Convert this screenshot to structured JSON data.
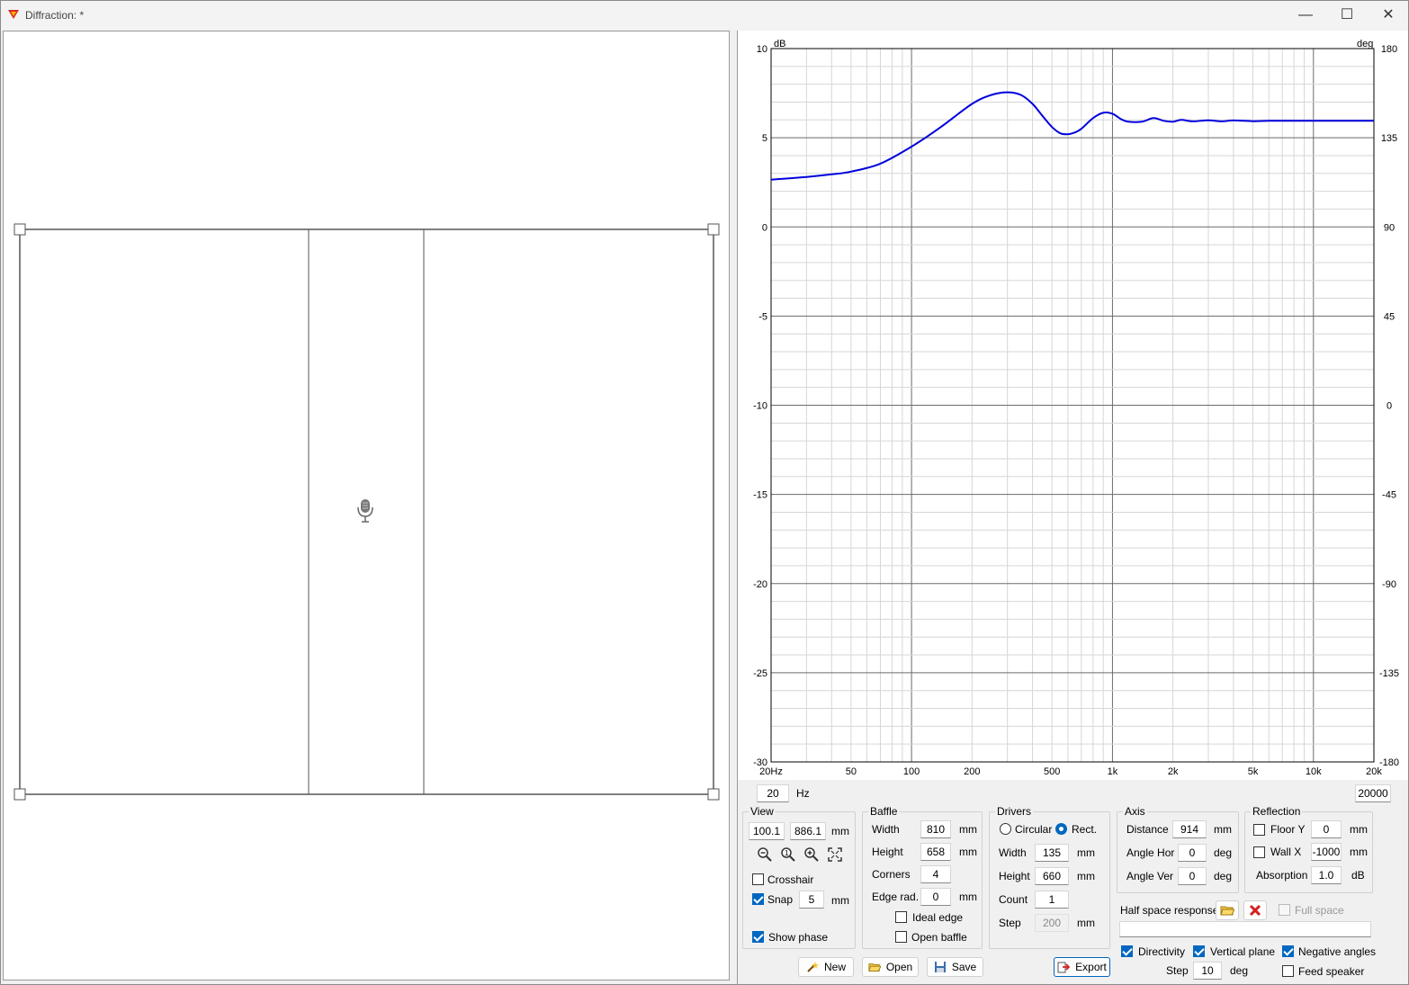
{
  "window": {
    "title": "Diffraction: *",
    "minimize": "—",
    "maximize": "☐",
    "close": "✕"
  },
  "chart_data": {
    "type": "line",
    "title": "",
    "xlabel": "",
    "ylabel": "dB",
    "y2label": "deg",
    "x_scale": "log",
    "xlim": [
      20,
      20000
    ],
    "ylim": [
      -30,
      10
    ],
    "y2lim": [
      -180,
      180
    ],
    "grid": true,
    "x_tick_labels": [
      "20Hz",
      "50",
      "100",
      "200",
      "500",
      "1k",
      "2k",
      "5k",
      "10k",
      "20k"
    ],
    "x_tick_values": [
      20,
      50,
      100,
      200,
      500,
      1000,
      2000,
      5000,
      10000,
      20000
    ],
    "y_tick_labels": [
      "10",
      "5",
      "0",
      "-5",
      "-10",
      "-15",
      "-20",
      "-25",
      "-30"
    ],
    "y2_tick_labels": [
      "180",
      "135",
      "90",
      "45",
      "0",
      "-45",
      "-90",
      "-135",
      "-180"
    ],
    "series": [
      {
        "color": "#0000dd",
        "x": [
          20,
          30,
          40,
          50,
          70,
          100,
          140,
          200,
          250,
          300,
          350,
          400,
          450,
          500,
          550,
          600,
          650,
          700,
          800,
          900,
          1000,
          1100,
          1200,
          1400,
          1600,
          1800,
          2000,
          2200,
          2500,
          3000,
          3500,
          4000,
          5000,
          6000,
          8000,
          10000,
          15000,
          20000
        ],
        "y": [
          2.65,
          2.8,
          2.95,
          3.1,
          3.55,
          4.5,
          5.6,
          6.9,
          7.4,
          7.55,
          7.4,
          6.9,
          6.2,
          5.6,
          5.25,
          5.2,
          5.3,
          5.5,
          6.1,
          6.4,
          6.35,
          6.05,
          5.9,
          5.9,
          6.1,
          5.95,
          5.9,
          6.0,
          5.92,
          5.98,
          5.92,
          5.97,
          5.93,
          5.95,
          5.95,
          5.95,
          5.95,
          5.95
        ]
      }
    ]
  },
  "freq_range": {
    "min": "20",
    "unit": "Hz",
    "max": "20000"
  },
  "view": {
    "title": "View",
    "x": "100.1",
    "y": "886.1",
    "unit": "mm",
    "crosshair_label": "Crosshair",
    "crosshair": false,
    "snap_label": "Snap",
    "snap": true,
    "snap_value": "5",
    "snap_unit": "mm",
    "show_phase_label": "Show phase",
    "show_phase": true
  },
  "baffle": {
    "title": "Baffle",
    "width_label": "Width",
    "width": "810",
    "width_unit": "mm",
    "height_label": "Height",
    "height": "658",
    "height_unit": "mm",
    "corners_label": "Corners",
    "corners": "4",
    "edge_rad_label": "Edge rad.",
    "edge_rad": "0",
    "edge_rad_unit": "mm",
    "ideal_edge_label": "Ideal edge",
    "ideal_edge": false,
    "open_baffle_label": "Open baffle",
    "open_baffle": false
  },
  "drivers": {
    "title": "Drivers",
    "circular_label": "Circular",
    "rect_label": "Rect.",
    "shape": "rect",
    "width_label": "Width",
    "width": "135",
    "width_unit": "mm",
    "height_label": "Height",
    "height": "660",
    "height_unit": "mm",
    "count_label": "Count",
    "count": "1",
    "step_label": "Step",
    "step": "200",
    "step_unit": "mm"
  },
  "axis": {
    "title": "Axis",
    "distance_label": "Distance",
    "distance": "914",
    "distance_unit": "mm",
    "angle_hor_label": "Angle Hor",
    "angle_hor": "0",
    "angle_hor_unit": "deg",
    "angle_ver_label": "Angle Ver",
    "angle_ver": "0",
    "angle_ver_unit": "deg"
  },
  "reflection": {
    "title": "Reflection",
    "floor_label": "Floor Y",
    "floor": false,
    "floor_value": "0",
    "floor_unit": "mm",
    "wall_label": "Wall  X",
    "wall": false,
    "wall_value": "-1000",
    "wall_unit": "mm",
    "absorption_label": "Absorption",
    "absorption": "1.0",
    "absorption_unit": "dB"
  },
  "half_space": {
    "label": "Half space response",
    "full_space_label": "Full space",
    "full_space": false,
    "file_value": ""
  },
  "directivity": {
    "directivity_label": "Directivity",
    "directivity": true,
    "vertical_plane_label": "Vertical plane",
    "vertical_plane": true,
    "negative_angles_label": "Negative angles",
    "negative_angles": true,
    "step_label": "Step",
    "step": "10",
    "step_unit": "deg",
    "feed_speaker_label": "Feed speaker",
    "feed_speaker": false
  },
  "buttons": {
    "new": "New",
    "open": "Open",
    "save": "Save",
    "export": "Export"
  }
}
